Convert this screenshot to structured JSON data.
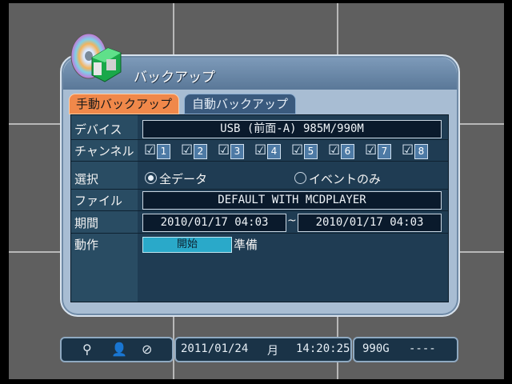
{
  "dialog": {
    "title": "バックアップ",
    "tabs": [
      {
        "label": "手動バックアップ",
        "active": true
      },
      {
        "label": "自動バックアップ",
        "active": false
      }
    ]
  },
  "rows": {
    "device": {
      "label": "デバイス",
      "value": "USB (前面-A) 985M/990M"
    },
    "channel": {
      "label": "チャンネル",
      "channels": [
        "1",
        "2",
        "3",
        "4",
        "5",
        "6",
        "7",
        "8"
      ]
    },
    "select": {
      "label": "選択",
      "options": [
        {
          "label": "全データ",
          "selected": true
        },
        {
          "label": "イベントのみ",
          "selected": false
        }
      ]
    },
    "file": {
      "label": "ファイル",
      "value": "DEFAULT WITH MCDPLAYER"
    },
    "period": {
      "label": "期間",
      "from": "2010/01/17 04:03",
      "separator": "~",
      "to": "2010/01/17 04:03"
    },
    "action": {
      "label": "動作",
      "button": "開始",
      "status": "準備"
    }
  },
  "statusbar": {
    "date": "2011/01/24",
    "weekday": "月",
    "time": "14:20:25",
    "storage": "990G",
    "extra": "----",
    "icons": [
      "usb-icon",
      "user-alert-icon",
      "network-off-icon"
    ]
  },
  "colors": {
    "accent_tab": "#f0884a",
    "panel_bg": "#1f3c53",
    "dialog_bg": "#a8bdd3"
  }
}
